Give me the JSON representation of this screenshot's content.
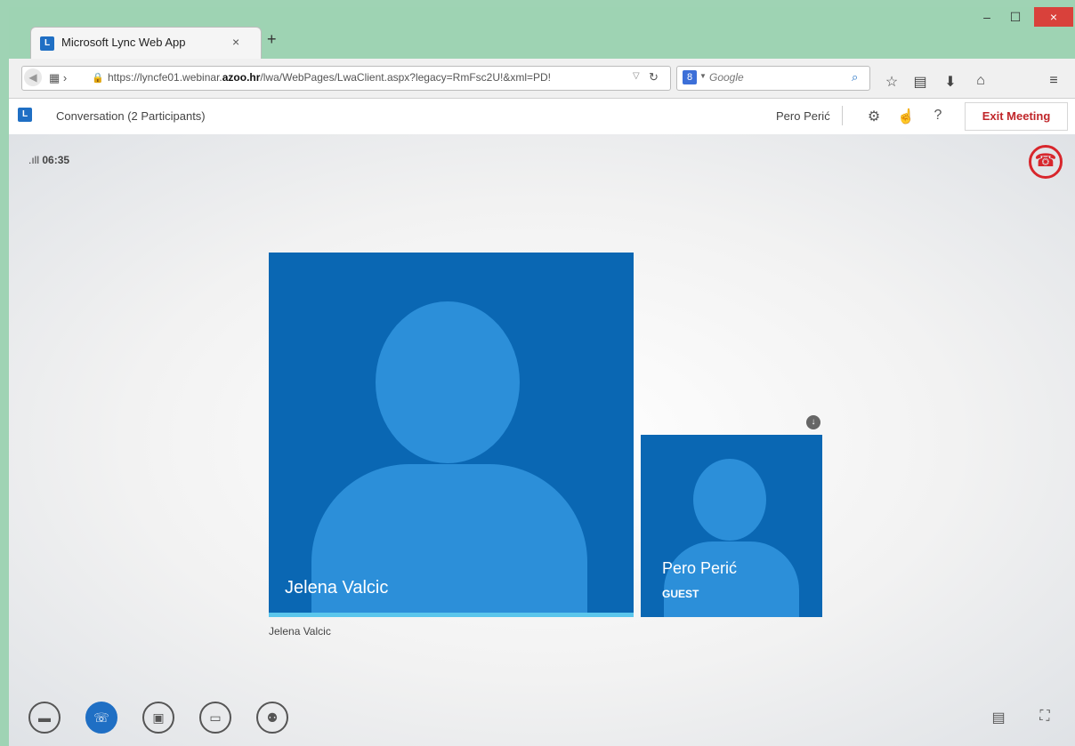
{
  "browser": {
    "tab_title": "Microsoft Lync Web App",
    "tab_close": "×",
    "new_tab": "+",
    "url_prefix": "https://lyncfe01.webinar.",
    "url_domain": "azoo.hr",
    "url_suffix": "/lwa/WebPages/LwaClient.aspx?legacy=RmFsc2U!&xml=PD!",
    "search_placeholder": "Google",
    "window_controls": {
      "minimize": "–",
      "maximize": "☐",
      "close": "×"
    }
  },
  "app": {
    "conversation_title": "Conversation (2 Participants)",
    "user_name": "Pero Perić",
    "exit_label": "Exit Meeting",
    "timer": "06:35",
    "signal": ".ıll"
  },
  "participants": [
    {
      "name": "Jelena Valcic",
      "caption": "Jelena Valcic"
    },
    {
      "name": "Pero Perić",
      "role": "GUEST"
    }
  ],
  "icons": {
    "back": "back-arrow-icon",
    "reload": "reload-icon",
    "settings": "gear-icon",
    "hangup": "phone-hangup-icon"
  },
  "colors": {
    "accent": "#1f6fc4",
    "tile": "#0a67b3",
    "avatar": "#2c8fd9",
    "hangup": "#d8262c",
    "titlebar": "#9ed3b3"
  }
}
